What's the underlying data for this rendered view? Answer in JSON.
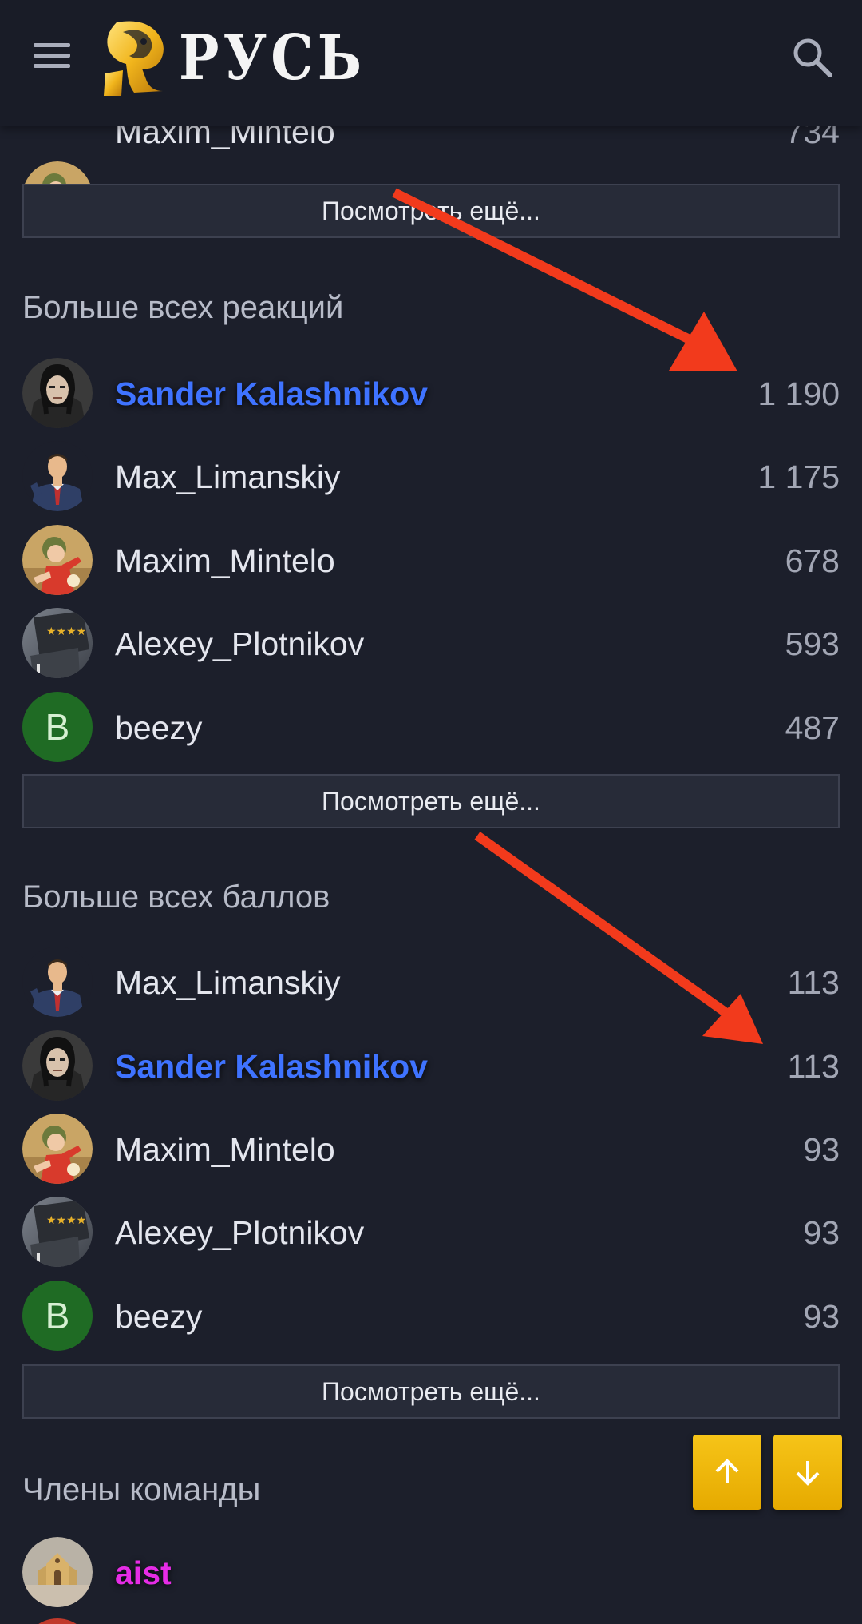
{
  "header": {
    "logo_text": "РУСЬ",
    "menu_icon": "hamburger-menu-icon",
    "search_icon": "search-icon"
  },
  "top_partial_row": {
    "name": "Maxim_Mintelo",
    "count": "734"
  },
  "more_label": "Посмотреть ещё...",
  "reactions": {
    "title": "Больше всех реакций",
    "rows": [
      {
        "name": "Sander Kalashnikov",
        "count": "1 190"
      },
      {
        "name": "Max_Limanskiy",
        "count": "1 175"
      },
      {
        "name": "Maxim_Mintelo",
        "count": "678"
      },
      {
        "name": "Alexey_Plotnikov",
        "count": "593"
      },
      {
        "name": "beezy",
        "count": "487",
        "avatar_letter": "B"
      }
    ]
  },
  "points": {
    "title": "Больше всех баллов",
    "rows": [
      {
        "name": "Max_Limanskiy",
        "count": "113"
      },
      {
        "name": "Sander Kalashnikov",
        "count": "113"
      },
      {
        "name": "Maxim_Mintelo",
        "count": "93"
      },
      {
        "name": "Alexey_Plotnikov",
        "count": "93"
      },
      {
        "name": "beezy",
        "count": "93",
        "avatar_letter": "B"
      }
    ]
  },
  "team": {
    "title": "Члены команды",
    "rows": [
      {
        "name": "aist"
      }
    ]
  },
  "scroll_buttons": {
    "up_icon": "arrow-up-icon",
    "down_icon": "arrow-down-icon"
  },
  "colors": {
    "background": "#1c1f2b",
    "header": "#191c27",
    "staff_name": "#3f73ff",
    "admin_name": "#e62ce6",
    "scroll_button": "#f2bc0c",
    "annotation_arrow": "#f23a1c",
    "letter_avatar": "#1f6b24"
  }
}
